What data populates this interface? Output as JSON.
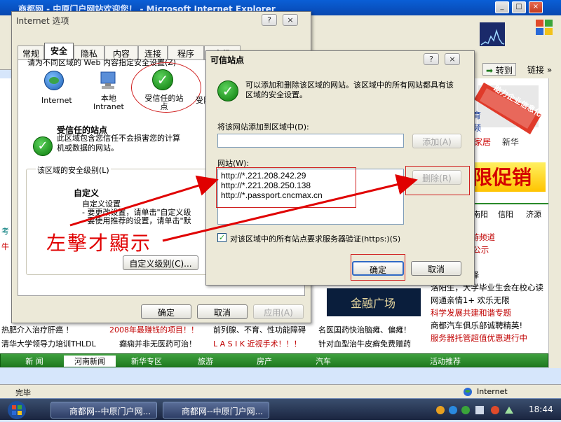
{
  "ie": {
    "title": "商都网 - 中原门户网站欢迎您！ - Microsoft Internet Explorer",
    "go_label": "转到",
    "links_label": "链接",
    "status": "完毕",
    "zone": "Internet"
  },
  "page": {
    "ad_big": "限促销",
    "ad_small": "助力企业信息化",
    "cities": [
      "南阳",
      "信阳",
      "济源"
    ],
    "right_lines": [
      "游频道",
      "公示",
      "。",
      "的办公新选择",
      "生会在校心读",
      "乐无限",
      "与谐专题",
      "成就精英!",
      "超值优惠进行中"
    ],
    "right_full": [
      "乱象就在旅游频道",
      "业务合作SP公示",
      "闪亮登场！",
      "的办公新选择",
      "洛阳生，大学毕业生会在校心读",
      "网通亲情1+  欢乐无限",
      "科学发展共建和谐专题",
      "商都汽车俱乐部诚聘精英!",
      "服务器托管超值优惠进行中"
    ],
    "bottom_rows": [
      [
        "热肥介入治疗肝癌 ！",
        "2008年最赚钱的项目！！",
        "前列腺、不育、性功能障碍",
        "名医国药快治脑瘫、偏瘫！"
      ],
      [
        "清华大学领导力培训THLDL",
        "癫痫并非无医药可治！",
        "L A S I K 近视手术！！！",
        "针对血型治牛皮癣免费赠药"
      ]
    ],
    "banner": "金融广场",
    "nav": [
      "新 闻",
      "河南新闻",
      "新华专区",
      "旅游",
      "房产",
      "汽车"
    ],
    "nav_right": "活动推荐",
    "nav_gray": "家居",
    "nav_gray2": "新华",
    "left_red": "牛",
    "left_teal": "考"
  },
  "options_dialog": {
    "title": "Internet 选项",
    "tabs": [
      "常规",
      "安全",
      "隐私",
      "内容",
      "连接",
      "程序",
      "高级"
    ],
    "zone_prompt": "请为不同区域的 Web 内容指定安全设置(Z)",
    "zones": [
      "Internet",
      "本地\nIntranet",
      "受信任的站点",
      "受限"
    ],
    "zone_title": "受信任的站点",
    "zone_desc": "此区域包含您信任不会损害您的计算机或数据的网站。",
    "level_label": "该区域的安全级别(L)",
    "custom_title": "自定义",
    "custom_lines": [
      "自定义设置",
      "- 要更改设置，请单击\"自定义级",
      "- 要使用推荐的设置，请单击\"默"
    ],
    "custom_btn": "自定义级别(C)...",
    "ok": "确定",
    "cancel": "取消",
    "apply": "应用(A)"
  },
  "trusted_dialog": {
    "title": "可信站点",
    "desc": "可以添加和删除该区域的网站。该区域中的所有网站都具有该区域的安全设置。",
    "add_label": "将该网站添加到区域中(D):",
    "add_value": "",
    "add_btn": "添加(A)",
    "sites_label": "网站(W):",
    "sites": [
      "http://*.221.208.242.29",
      "http://*.221.208.250.138",
      "http://*.passport.cncmax.cn"
    ],
    "remove_btn": "删除(R)",
    "https_label": "对该区域中的所有站点要求服务器验证(https:)(S)",
    "ok": "确定",
    "cancel": "取消"
  },
  "annotation": {
    "text": "左擊才顯示",
    "color": "#e00000"
  },
  "taskbar": {
    "items": [
      "商都网--中原门户网...",
      "商都网--中原门户网..."
    ],
    "time": "18:44"
  }
}
